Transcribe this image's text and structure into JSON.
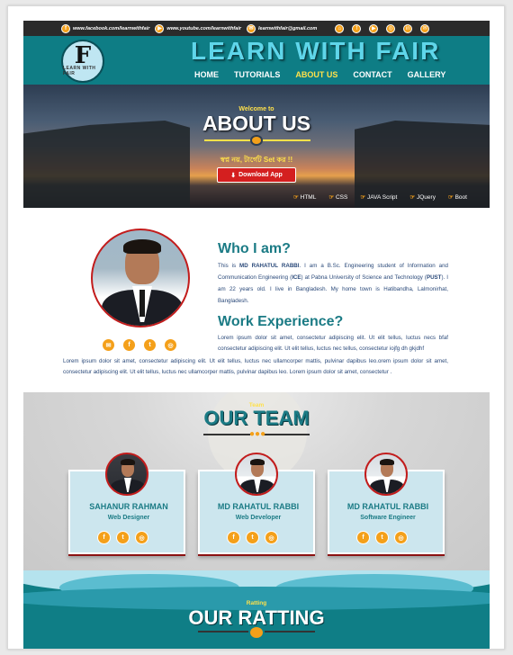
{
  "topbar": {
    "facebook": "www.facebook.com/learnwithfair",
    "youtube": "www.youtube.com/learnwithfair",
    "email": "learnwithfair@gmail.com",
    "social_icons": [
      "home-icon",
      "facebook-icon",
      "youtube-icon",
      "instagram-icon",
      "linkedin-icon",
      "mail-icon"
    ]
  },
  "header": {
    "logo_letter": "F",
    "logo_caption": "LEARN WITH FAIR",
    "brand": "LEARN WITH FAIR",
    "nav": [
      "HOME",
      "TUTORIALS",
      "ABOUT US",
      "CONTACT",
      "GALLERY"
    ],
    "active_nav": "ABOUT US"
  },
  "hero": {
    "welcome": "Welcome to",
    "title": "ABOUT US",
    "tagline": "স্বপ্ন নয়, টার্গেট Set কর !!",
    "download_label": "Download App",
    "ticker": [
      "HTML",
      "CSS",
      "JAVA Script",
      "JQuery",
      "Boot"
    ]
  },
  "about": {
    "who_heading": "Who I am?",
    "who_name": "MD RAHATUL RABBI",
    "who_text_1": "This is ",
    "who_text_2": ". I am a B.Sc. Engineering student of Information and Communication Engineering (",
    "who_ice": "ICE",
    "who_text_3": ") at Pabna University of Science and Technology (",
    "who_pust": "PUST",
    "who_text_4": ").  I am 22 years old. I live in Bangladesh. My home town is Hatibandha, Lalmonirhat, Bangladesh.",
    "work_heading": "Work Experience?",
    "work_text_1": "Lorem ipsum dolor sit amet, consectetur adipiscing elit. Ut elit tellus, luctus necs bfaf consectetur adipiscing elit. Ut elit tellus, luctus nec tellus,  consectetur iojfg dh gkjdhf",
    "work_text_2": "Lorem ipsum dolor sit amet, consectetur adipiscing elit. Ut elit tellus, luctus nec ullamcorper mattis, pulvinar dapibus leo.orem ipsum dolor sit amet, consectetur adipiscing elit. Ut elit tellus, luctus nec ullamcorper mattis, pulvinar dapibus leo. Lorem ipsum dolor sit amet, consectetur ."
  },
  "team": {
    "subtitle": "Team",
    "title": "OUR TEAM",
    "members": [
      {
        "name": "SAHANUR RAHMAN",
        "role": "Web Designer"
      },
      {
        "name": "MD RAHATUL RABBI",
        "role": "Web Developer"
      },
      {
        "name": "MD RAHATUL RABBI",
        "role": "Software Engineer"
      }
    ]
  },
  "rating": {
    "subtitle": "Ratting",
    "title": "OUR RATTING"
  },
  "colors": {
    "teal": "#0e7d85",
    "orange": "#f4a01a",
    "yellow": "#ffe14a",
    "red": "#d41f1f"
  }
}
